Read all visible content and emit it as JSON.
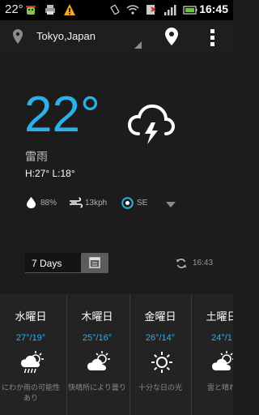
{
  "status_bar": {
    "temp": "22°",
    "time": "16:45",
    "icons": [
      "weather-temp-icon",
      "android-debug-icon",
      "printer-icon",
      "warning-icon",
      "vibrate-icon",
      "wifi-icon",
      "no-sim-icon",
      "signal-icon",
      "battery-icon"
    ]
  },
  "location": {
    "name": "Tokyo,Japan"
  },
  "current": {
    "temp": "22°",
    "condition": "雷雨",
    "hilo": "H:27°  L:18°",
    "humidity": "88%",
    "wind": "13kph",
    "direction": "SE",
    "icon": "thunderstorm-icon"
  },
  "controls": {
    "days_label": "7 Days",
    "updated": "16:43"
  },
  "forecast": [
    {
      "day": "水曜日",
      "temps": "27°/19°",
      "icon": "cloud-rain-sun-icon",
      "desc": "にわか雨の可能性あり"
    },
    {
      "day": "木曜日",
      "temps": "25°/16°",
      "icon": "cloud-sun-icon",
      "desc": "快晴所により曇り"
    },
    {
      "day": "金曜日",
      "temps": "26°/14°",
      "icon": "sun-icon",
      "desc": "十分な日の光"
    },
    {
      "day": "土曜日",
      "temps": "24°/1",
      "icon": "cloud-sun-icon",
      "desc": "雲と晴れ"
    }
  ],
  "colors": {
    "accent": "#2bb0ec",
    "background": "#1c1c1c",
    "forecast_bg": "#232323"
  }
}
